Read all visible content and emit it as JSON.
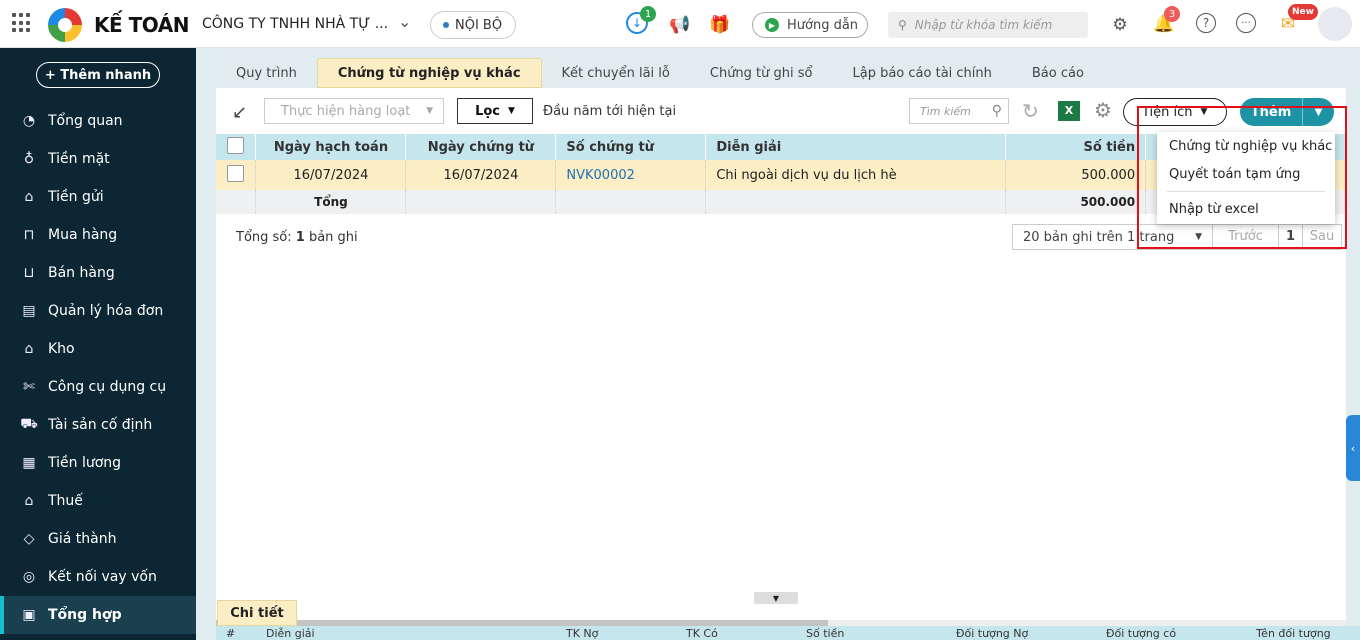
{
  "topbar": {
    "logo_text": "KẾ TOÁN",
    "company": "CÔNG TY TNHH NHÀ TỰ ...",
    "scope": "NỘI BỘ",
    "download_badge": "1",
    "guide": "Hướng dẫn",
    "search_placeholder": "Nhập từ khóa tìm kiếm",
    "notify_badge": "3",
    "new_badge": "New"
  },
  "sidebar": {
    "quick_add": "+ Thêm nhanh",
    "items": [
      {
        "label": "Tổng quan",
        "icon": "dashboard-icon"
      },
      {
        "label": "Tiền mặt",
        "icon": "money-bag-icon"
      },
      {
        "label": "Tiền gửi",
        "icon": "bank-icon"
      },
      {
        "label": "Mua hàng",
        "icon": "shopping-bag-icon"
      },
      {
        "label": "Bán hàng",
        "icon": "cart-icon"
      },
      {
        "label": "Quản lý hóa đơn",
        "icon": "invoice-icon"
      },
      {
        "label": "Kho",
        "icon": "warehouse-icon"
      },
      {
        "label": "Công cụ dụng cụ",
        "icon": "tools-icon"
      },
      {
        "label": "Tài sản cố định",
        "icon": "asset-icon"
      },
      {
        "label": "Tiền lương",
        "icon": "salary-icon"
      },
      {
        "label": "Thuế",
        "icon": "tax-icon"
      },
      {
        "label": "Giá thành",
        "icon": "price-tag-icon"
      },
      {
        "label": "Kết nối vay vốn",
        "icon": "loan-icon"
      },
      {
        "label": "Tổng hợp",
        "icon": "summary-icon"
      }
    ]
  },
  "tabs": [
    "Quy trình",
    "Chứng từ nghiệp vụ khác",
    "Kết chuyển lãi lỗ",
    "Chứng từ ghi sổ",
    "Lập báo cáo tài chính",
    "Báo cáo"
  ],
  "toolbar": {
    "batch": "Thực hiện hàng loạt",
    "filter": "Lọc",
    "period": "Đầu năm tới hiện tại",
    "search_placeholder": "Tìm kiếm",
    "utilities": "Tiện ích",
    "add": "Thêm"
  },
  "table": {
    "headers": [
      "Ngày hạch toán",
      "Ngày chứng từ",
      "Số chứng từ",
      "Diễn giải",
      "Số tiền"
    ],
    "rows": [
      {
        "ngay_hach_toan": "16/07/2024",
        "ngay_chung_tu": "16/07/2024",
        "so_chung_tu": "NVK00002",
        "dien_giai": "Chi ngoài dịch vụ du lịch hè",
        "so_tien": "500.000"
      }
    ],
    "total_label": "Tổng",
    "total_value": "500.000"
  },
  "footer": {
    "total_prefix": "Tổng số:",
    "total_count": "1",
    "total_suffix": "bản ghi",
    "page_size": "20 bản ghi trên 1 trang",
    "prev": "Trước",
    "page": "1",
    "next": "Sau"
  },
  "dropdown": [
    "Chứng từ nghiệp vụ khác",
    "Quyết toán tạm ứng",
    "Nhập từ excel"
  ],
  "detail": {
    "tab": "Chi tiết",
    "headers": [
      "#",
      "Diễn giải",
      "TK Nợ",
      "TK Có",
      "Số tiền",
      "Đối tượng Nợ",
      "Đối tượng có",
      "Tên đối tượng"
    ]
  }
}
